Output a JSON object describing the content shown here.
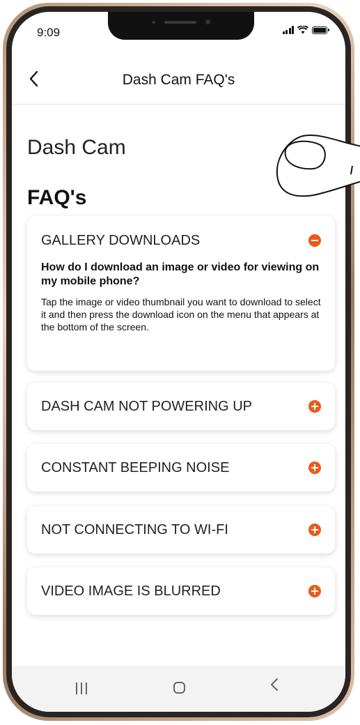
{
  "status_bar": {
    "time": "9:09"
  },
  "header": {
    "title": "Dash Cam FAQ's",
    "back_icon": "chevron-left"
  },
  "page": {
    "subtitle": "Dash Cam",
    "title": "FAQ's"
  },
  "faq": [
    {
      "title": "GALLERY DOWNLOADS",
      "expanded": true,
      "question": "How do I download an image or video for viewing on my mobile phone?",
      "answer": "Tap the image or video thumbnail you want to download to select it and then press the download icon on the menu that appears at the bottom of the screen."
    },
    {
      "title": "DASH CAM NOT POWERING UP",
      "expanded": false
    },
    {
      "title": "CONSTANT BEEPING NOISE",
      "expanded": false
    },
    {
      "title": "NOT CONNECTING TO WI-FI",
      "expanded": false
    },
    {
      "title": "VIDEO IMAGE IS BLURRED",
      "expanded": false
    }
  ],
  "colors": {
    "accent": "#ea5a1a",
    "frame": "#2a2522"
  },
  "nav_bar": {
    "icons": [
      "recents-icon",
      "home-icon",
      "back-icon"
    ]
  }
}
